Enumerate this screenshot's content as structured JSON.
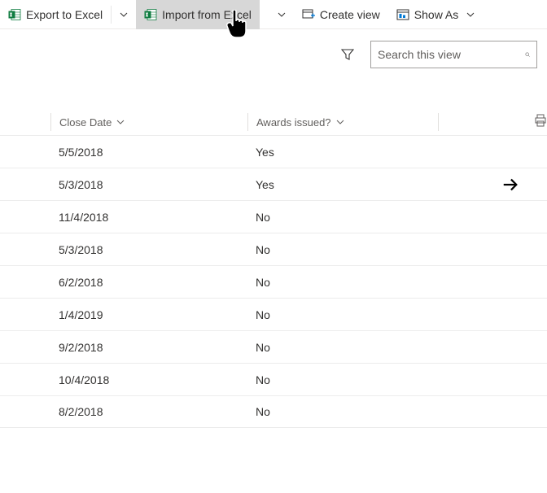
{
  "toolbar": {
    "export_label": "Export to Excel",
    "import_label": "Import from Excel",
    "create_view_label": "Create view",
    "show_as_label": "Show As"
  },
  "search": {
    "placeholder": "Search this view"
  },
  "columns": {
    "close_date": "Close Date",
    "awards": "Awards issued?"
  },
  "rows": [
    {
      "close_date": "5/5/2018",
      "awards": "Yes",
      "action": false
    },
    {
      "close_date": "5/3/2018",
      "awards": "Yes",
      "action": true
    },
    {
      "close_date": "11/4/2018",
      "awards": "No",
      "action": false
    },
    {
      "close_date": "5/3/2018",
      "awards": "No",
      "action": false
    },
    {
      "close_date": "6/2/2018",
      "awards": "No",
      "action": false
    },
    {
      "close_date": "1/4/2019",
      "awards": "No",
      "action": false
    },
    {
      "close_date": "9/2/2018",
      "awards": "No",
      "action": false
    },
    {
      "close_date": "10/4/2018",
      "awards": "No",
      "action": false
    },
    {
      "close_date": "8/2/2018",
      "awards": "No",
      "action": false
    }
  ]
}
